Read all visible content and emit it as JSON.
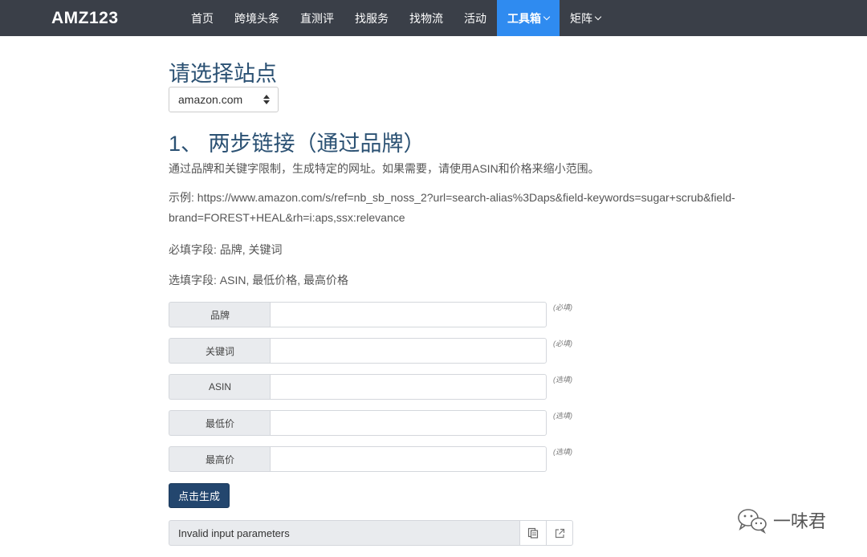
{
  "navbar": {
    "brand": "AMZ123",
    "items": [
      {
        "label": "首页",
        "active": false,
        "dropdown": false
      },
      {
        "label": "跨境头条",
        "active": false,
        "dropdown": false
      },
      {
        "label": "直测评",
        "active": false,
        "dropdown": false
      },
      {
        "label": "找服务",
        "active": false,
        "dropdown": false
      },
      {
        "label": "找物流",
        "active": false,
        "dropdown": false
      },
      {
        "label": "活动",
        "active": false,
        "dropdown": false
      },
      {
        "label": "工具箱",
        "active": true,
        "dropdown": true
      },
      {
        "label": "矩阵",
        "active": false,
        "dropdown": true
      }
    ]
  },
  "site": {
    "title": "请选择站点",
    "selected": "amazon.com"
  },
  "section": {
    "title": "1、 两步链接（通过品牌）",
    "description": "通过品牌和关键字限制，生成特定的网址。如果需要，请使用ASIN和价格来缩小范围。",
    "example_line1": "示例: https://www.amazon.com/s/ref=nb_sb_noss_2?url=search-alias%3Daps&field-keywords=sugar+scrub&field-",
    "example_line2": "brand=FOREST+HEAL&rh=i:aps,ssx:relevance",
    "required_fields": "必填字段: 品牌, 关键词",
    "optional_fields": "选填字段: ASIN, 最低价格, 最高价格"
  },
  "form": {
    "fields": [
      {
        "label": "品牌",
        "value": "",
        "hint": "(必填)"
      },
      {
        "label": "关键词",
        "value": "",
        "hint": "(必填)"
      },
      {
        "label": "ASIN",
        "value": "",
        "hint": "(选填)"
      },
      {
        "label": "最低价",
        "value": "",
        "hint": "(选填)"
      },
      {
        "label": "最高价",
        "value": "",
        "hint": "(选填)"
      }
    ],
    "generate_label": "点击生成"
  },
  "result": {
    "text": "Invalid input parameters"
  },
  "watermark": {
    "text": "一味君"
  },
  "colors": {
    "navbar_bg": "#3a3f48",
    "nav_active": "#2f8bf0",
    "title": "#2b5173",
    "button": "#23466e"
  },
  "icons": {
    "copy": "copy-icon",
    "open": "external-link-icon",
    "watermark": "wechat-icon"
  }
}
